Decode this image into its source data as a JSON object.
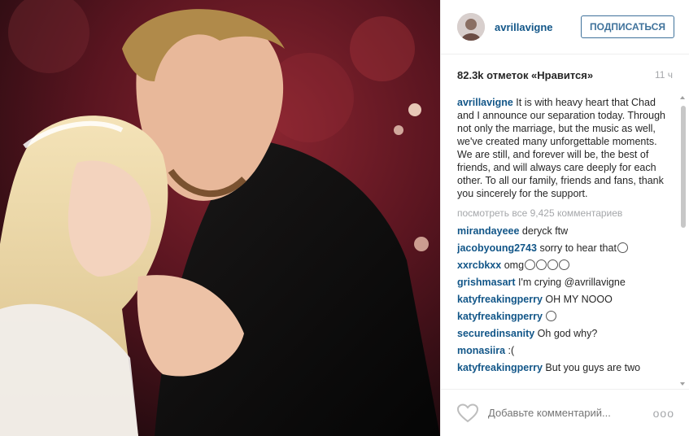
{
  "header": {
    "username": "avrillavigne",
    "follow_label": "ПОДПИСАТЬСЯ"
  },
  "stats": {
    "likes": "82.3k отметок «Нравится»",
    "time": "11 ч"
  },
  "caption": {
    "username": "avrillavigne",
    "text": "It is with heavy heart that Chad and I announce our separation today. Through not only the marriage, but the music as well, we've created many unforgettable moments. We are still, and forever will be, the best of friends, and will always care deeply for each other. To all our family, friends and fans, thank you sincerely for the support."
  },
  "view_all": "посмотреть все 9,425 комментариев",
  "comments": [
    {
      "user": "mirandayeee",
      "text": "deryck ftw"
    },
    {
      "user": "jacobyoung2743",
      "text": "sorry to hear that"
    },
    {
      "user": "xxrcbkxx",
      "text": "omg"
    },
    {
      "user": "grishmasart",
      "text": "I'm crying @avrillavigne"
    },
    {
      "user": "katyfreakingperry",
      "text": "OH MY NOOO"
    },
    {
      "user": "katyfreakingperry",
      "text": ""
    },
    {
      "user": "securedinsanity",
      "text": "Oh god why?"
    },
    {
      "user": "monasiira",
      "text": ":("
    },
    {
      "user": "katyfreakingperry",
      "text": "But you guys are two"
    }
  ],
  "footer": {
    "placeholder": "Добавьте комментарий...",
    "more": "ooo"
  },
  "icons": {
    "heart": "heart-outline-icon",
    "more": "more-options-icon"
  },
  "colors": {
    "username": "#125688",
    "follow_border": "#3f729b",
    "muted": "#a5a7aa"
  }
}
